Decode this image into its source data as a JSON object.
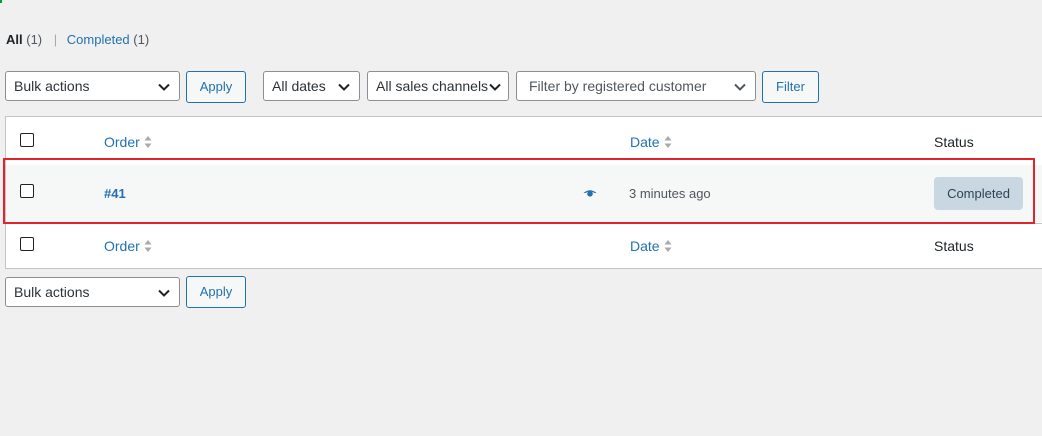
{
  "views": {
    "all_label": "All",
    "all_count": "(1)",
    "separator": "|",
    "completed_label": "Completed",
    "completed_count": "(1)"
  },
  "filters_top": {
    "bulk_actions": "Bulk actions",
    "apply": "Apply",
    "dates": "All dates",
    "channels": "All sales channels",
    "customer": "Filter by registered customer",
    "filter": "Filter"
  },
  "table": {
    "columns": {
      "order": "Order",
      "date": "Date",
      "status": "Status"
    },
    "rows": [
      {
        "order": "#41",
        "date": "3 minutes ago",
        "status": "Completed"
      }
    ]
  },
  "filters_bottom": {
    "bulk_actions": "Bulk actions",
    "apply": "Apply"
  },
  "colors": {
    "link": "#2271b1",
    "status_completed_bg": "#c8d7e1",
    "status_completed_fg": "#2e4453",
    "highlight": "#e3222b"
  },
  "icons": {
    "preview": "eye-icon",
    "sort": "sort-arrows-icon",
    "dropdown": "chevron-down-icon"
  }
}
